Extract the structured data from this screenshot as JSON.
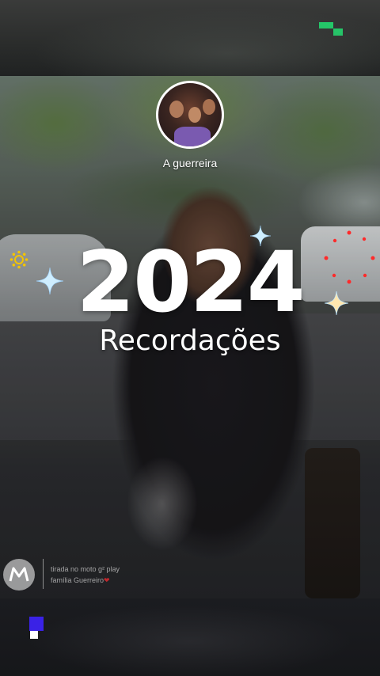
{
  "profile": {
    "name": "A guerreira"
  },
  "story": {
    "year": "2024",
    "subtitle": "Recordações"
  },
  "watermark": {
    "line1": "tirada no moto g² play",
    "line2": "família Guerreiro",
    "heart": "❤"
  },
  "colors": {
    "app_logo": "#1fd16a",
    "bottom_logo": "#3a22e6",
    "sparkle": "#bfe7ff",
    "dots": "#ff2a2a",
    "sun": "#f3c400"
  },
  "icons": [
    "app-logo-icon",
    "sparkle-icon",
    "sun-icon",
    "motorola-logo-icon",
    "bottom-logo-icon"
  ]
}
